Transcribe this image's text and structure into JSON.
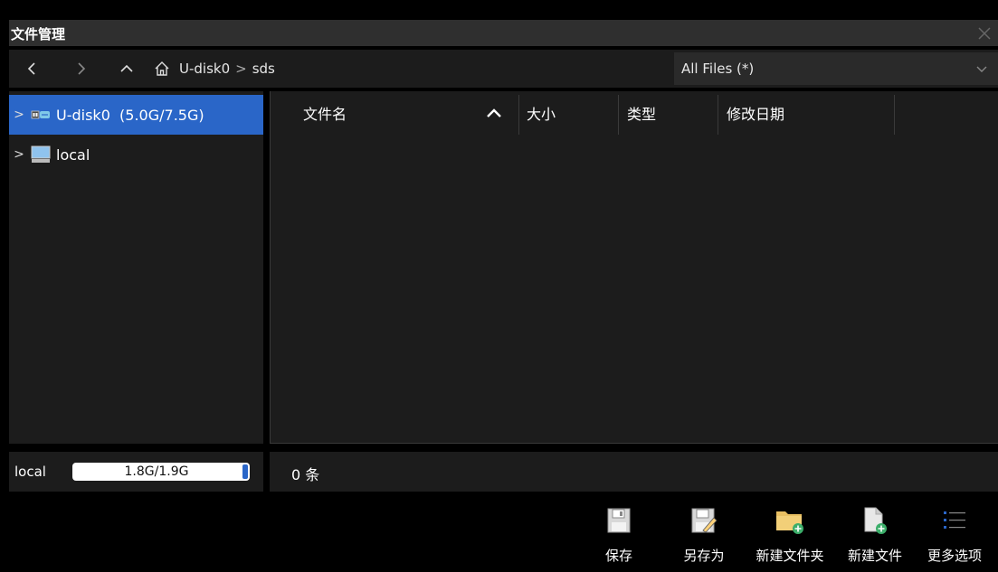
{
  "window": {
    "title": "文件管理"
  },
  "nav": {
    "back_icon": "chevron-left-icon",
    "forward_icon": "chevron-right-icon",
    "up_icon": "chevron-up-icon",
    "home_icon": "home-icon",
    "breadcrumb": [
      "U-disk0",
      "sds"
    ],
    "filter": "All Files (*)"
  },
  "tree": {
    "items": [
      {
        "label": "U-disk0  (5.0G/7.5G)",
        "icon": "usb-drive-icon",
        "selected": true
      },
      {
        "label": "local",
        "icon": "computer-icon",
        "selected": false
      }
    ]
  },
  "list": {
    "columns": [
      "文件名",
      "大小",
      "类型",
      "修改日期"
    ],
    "sort_indicator": "^",
    "rows": []
  },
  "storage": {
    "name": "local",
    "usage": "1.8G/1.9G",
    "used_fraction": 0.95
  },
  "status": {
    "count": "0 条"
  },
  "toolbar": {
    "save": "保存",
    "save_as": "另存为",
    "new_folder": "新建文件夹",
    "new_file": "新建文件",
    "more": "更多选项"
  },
  "colors": {
    "accent": "#2a66c8",
    "panel": "#1c1c1c",
    "background": "#000000"
  }
}
